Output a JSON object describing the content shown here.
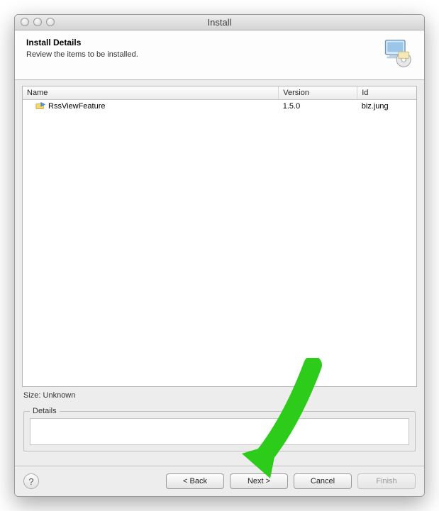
{
  "window": {
    "title": "Install"
  },
  "banner": {
    "heading": "Install Details",
    "subheading": "Review the items to be installed."
  },
  "table": {
    "headers": {
      "name": "Name",
      "version": "Version",
      "id": "Id"
    },
    "rows": [
      {
        "name": "RssViewFeature",
        "version": "1.5.0",
        "id": "biz.jung"
      }
    ]
  },
  "size_label": "Size: Unknown",
  "details": {
    "legend": "Details",
    "text": ""
  },
  "buttons": {
    "back": "< Back",
    "next": "Next >",
    "cancel": "Cancel",
    "finish": "Finish"
  }
}
